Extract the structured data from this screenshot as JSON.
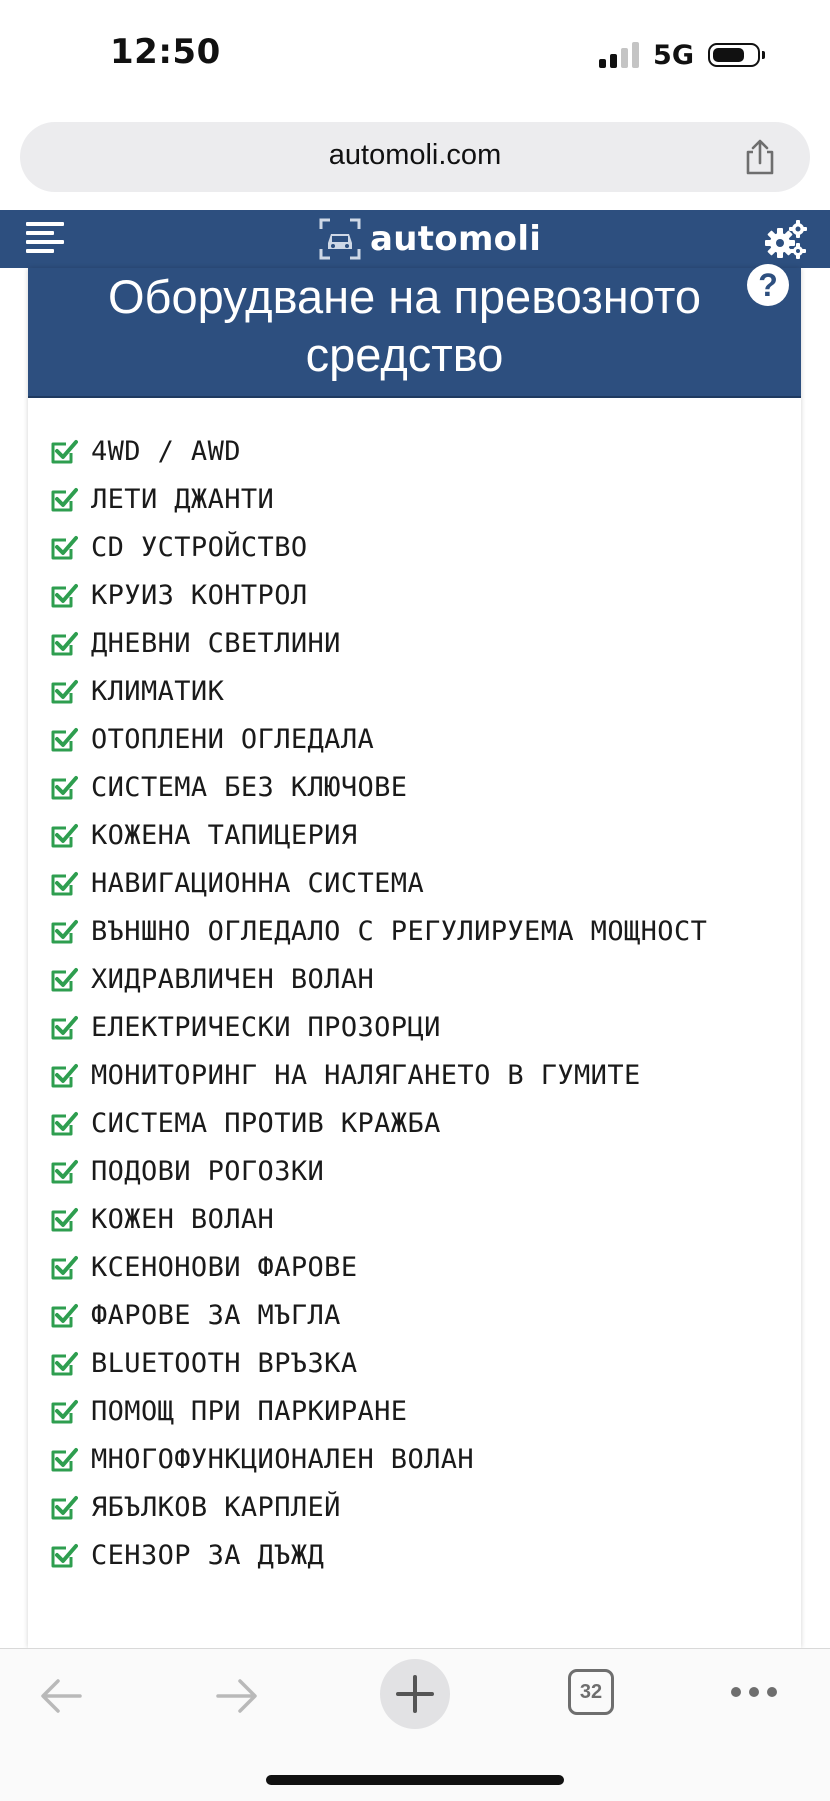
{
  "status_bar": {
    "time": "12:50",
    "network": "5G",
    "signal_icon": "cellular-signal-icon",
    "battery_icon": "battery-icon"
  },
  "browser": {
    "url": "automoli.com",
    "share_icon": "share-icon",
    "tab_count": "32",
    "back_icon": "back-arrow-icon",
    "forward_icon": "forward-arrow-icon",
    "new_tab_icon": "plus-icon",
    "more_icon": "more-dots-icon"
  },
  "site_header": {
    "brand": "automoli",
    "menu_icon": "hamburger-menu-icon",
    "settings_icon": "gears-icon",
    "color": "#2d4f7f"
  },
  "equipment": {
    "title": "Оборудване на превозното средство",
    "help_icon": "question-icon",
    "check_color": "#2e9e4f",
    "items": [
      "4WD / AWD",
      "ЛЕТИ ДЖАНТИ",
      "CD УСТРОЙСТВО",
      "КРУИЗ КОНТРОЛ",
      "ДНЕВНИ СВЕТЛИНИ",
      "КЛИМАТИК",
      "ОТОПЛЕНИ ОГЛЕДАЛА",
      "СИСТЕМА БЕЗ КЛЮЧОВЕ",
      "КОЖЕНА ТАПИЦЕРИЯ",
      "НАВИГАЦИОННА СИСТЕМА",
      "ВЪНШНО ОГЛЕДАЛО С РЕГУЛИРУЕМА МОЩНОСТ",
      "ХИДРАВЛИЧЕН ВОЛАН",
      "ЕЛЕКТРИЧЕСКИ ПРОЗОРЦИ",
      "МОНИТОРИНГ НА НАЛЯГАНЕТО В ГУМИТЕ",
      "СИСТЕМА ПРОТИВ КРАЖБА",
      "ПОДОВИ РОГОЗКИ",
      "КОЖЕН ВОЛАН",
      "КСЕНОНОВИ ФАРОВЕ",
      "ФАРОВЕ ЗА МЪГЛА",
      "BLUETOOTH ВРЪЗКА",
      "ПОМОЩ ПРИ ПАРКИРАНЕ",
      "МНОГОФУНКЦИОНАЛЕН ВОЛАН",
      "ЯБЪЛКОВ КАРПЛЕЙ",
      "СЕНЗОР ЗА ДЪЖД"
    ]
  }
}
